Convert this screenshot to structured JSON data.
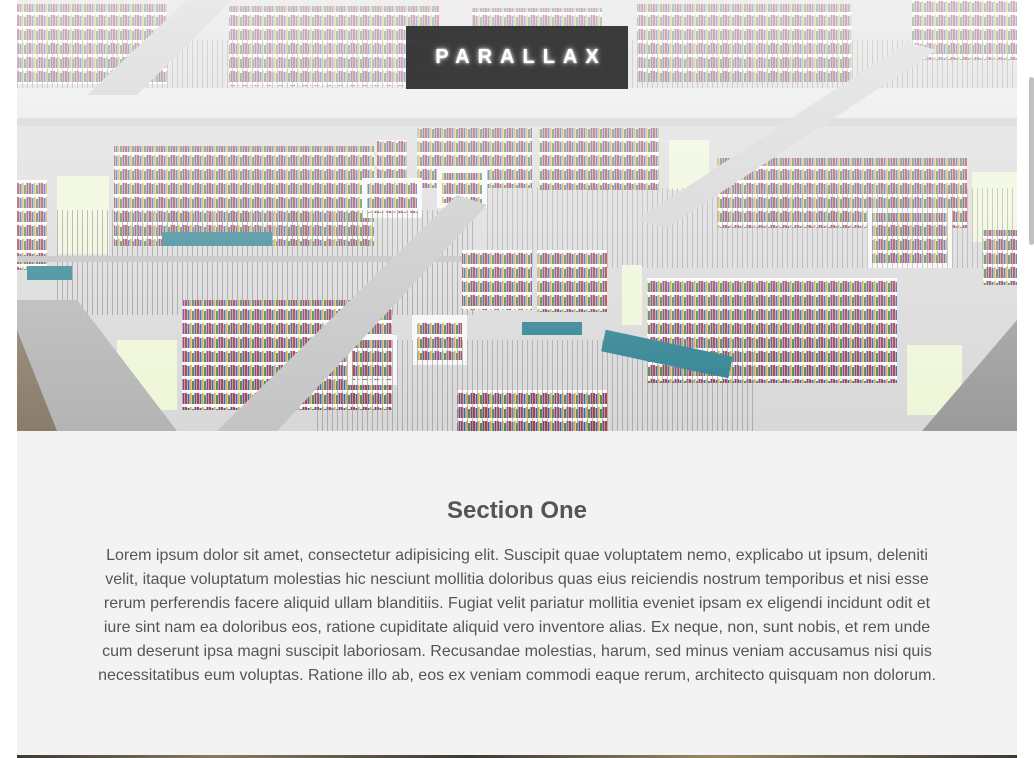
{
  "hero": {
    "title": "PARALLAX"
  },
  "section_one": {
    "heading": "Section One",
    "body": "Lorem ipsum dolor sit amet, consectetur adipisicing elit. Suscipit quae voluptatem nemo, explicabo ut ipsum, deleniti velit, itaque voluptatum molestias hic nesciunt mollitia doloribus quas eius reiciendis nostrum temporibus et nisi esse rerum perferendis facere aliquid ullam blanditiis. Fugiat velit pariatur mollitia eveniet ipsam ex eligendi incidunt odit et iure sint nam ea doloribus eos, ratione cupiditate aliquid vero inventore alias. Ex neque, non, sunt nobis, et rem unde cum deserunt ipsa magni suscipit laboriosam. Recusandae molestias, harum, sed minus veniam accusamus nisi quis necessitatibus eum voluptas. Ratione illo ab, eos ex veniam commodi eaque rerum, architecto quisquam non dolorum."
  },
  "colors": {
    "title_box": "#333333",
    "section_background": "#f3f3f3",
    "text": "#555555",
    "bench": "#2a7f8f"
  },
  "images": {
    "hero_image": "library-interior-photo"
  }
}
